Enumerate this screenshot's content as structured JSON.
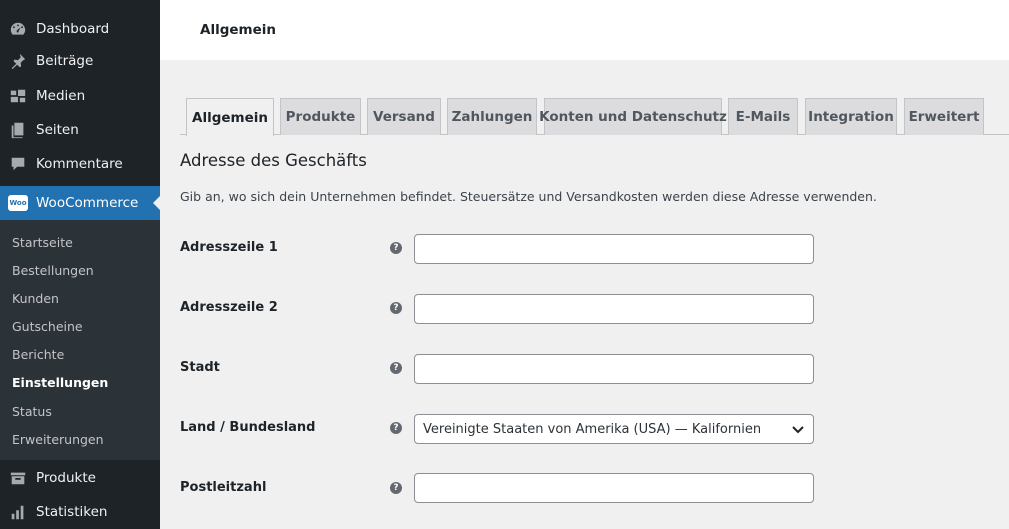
{
  "sidebar": {
    "menu": [
      {
        "label": "Dashboard",
        "icon": "dashboard-icon"
      },
      {
        "label": "Beiträge",
        "icon": "pin-icon"
      },
      {
        "label": "Medien",
        "icon": "media-icon"
      },
      {
        "label": "Seiten",
        "icon": "pages-icon"
      },
      {
        "label": "Kommentare",
        "icon": "comment-icon"
      },
      {
        "label": "WooCommerce",
        "icon": "woocommerce-icon"
      }
    ],
    "woo_badge": "Woo",
    "submenu": [
      "Startseite",
      "Bestellungen",
      "Kunden",
      "Gutscheine",
      "Berichte",
      "Einstellungen",
      "Status",
      "Erweiterungen"
    ],
    "bottom_menu": [
      {
        "label": "Produkte",
        "icon": "products-icon"
      },
      {
        "label": "Statistiken",
        "icon": "bar-chart-icon"
      }
    ]
  },
  "header": {
    "title": "Allgemein"
  },
  "tabs": [
    "Allgemein",
    "Produkte",
    "Versand",
    "Zahlungen",
    "Konten und Datenschutz",
    "E-Mails",
    "Integration",
    "Erweitert"
  ],
  "section": {
    "title": "Adresse des Geschäfts",
    "description": "Gib an, wo sich dein Unternehmen befindet. Steuersätze und Versandkosten werden diese Adresse verwenden."
  },
  "form": {
    "address1_label": "Adresszeile 1",
    "address2_label": "Adresszeile 2",
    "city_label": "Stadt",
    "country_label": "Land / Bundesland",
    "country_value": "Vereinigte Staaten von Amerika (USA) — Kalifornien",
    "postcode_label": "Postleitzahl",
    "help_glyph": "?"
  },
  "colors": {
    "sidebar": "#1d2327",
    "accent": "#2271b1",
    "background": "#f0f0f1"
  }
}
